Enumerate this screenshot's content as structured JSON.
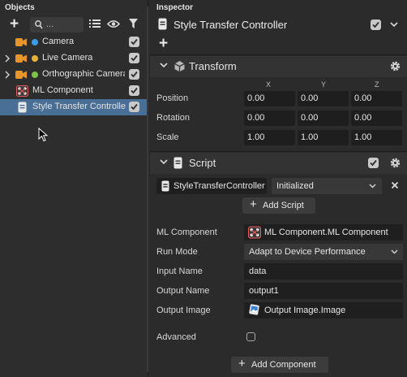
{
  "objects_panel": {
    "title": "Objects",
    "search": {
      "value": "...",
      "placeholder": ""
    },
    "items": [
      {
        "label": "Camera",
        "icon": "camera-icon",
        "dot_color": "#3a9ee6",
        "expandable": false,
        "checked": true,
        "selected": false
      },
      {
        "label": "Live Camera",
        "icon": "camera-icon",
        "dot_color": "#e6b23a",
        "expandable": true,
        "checked": true,
        "selected": false
      },
      {
        "label": "Orthographic Camera",
        "icon": "camera-icon",
        "dot_color": "#7fc24a",
        "expandable": true,
        "checked": true,
        "selected": false
      },
      {
        "label": "ML Component",
        "icon": "ml-component-icon",
        "dot_color": "",
        "expandable": false,
        "checked": true,
        "selected": false
      },
      {
        "label": "Style Transfer Controller",
        "icon": "script-icon",
        "dot_color": "",
        "expandable": false,
        "checked": true,
        "selected": true
      }
    ]
  },
  "inspector": {
    "title": "Inspector",
    "object_name": "Style Transfer Controller",
    "transform": {
      "title": "Transform",
      "axes": [
        "X",
        "Y",
        "Z"
      ],
      "rows": [
        {
          "label": "Position",
          "values": [
            "0.00",
            "0.00",
            "0.00"
          ]
        },
        {
          "label": "Rotation",
          "values": [
            "0.00",
            "0.00",
            "0.00"
          ]
        },
        {
          "label": "Scale",
          "values": [
            "1.00",
            "1.00",
            "1.00"
          ]
        }
      ]
    },
    "script": {
      "title": "Script",
      "script_file": "StyleTransferController",
      "status": "Initialized",
      "add_script_label": "Add Script",
      "fields": {
        "ml_component": {
          "label": "ML Component",
          "value": "ML Component.ML Component"
        },
        "run_mode": {
          "label": "Run Mode",
          "value": "Adapt to Device Performance"
        },
        "input_name": {
          "label": "Input Name",
          "value": "data"
        },
        "output_name": {
          "label": "Output Name",
          "value": "output1"
        },
        "output_image": {
          "label": "Output Image",
          "value": "Output Image.Image"
        },
        "advanced": {
          "label": "Advanced",
          "checked": false
        }
      }
    },
    "add_component_label": "Add Component"
  },
  "colors": {
    "panel_bg": "#2b2b2b",
    "selection": "#4a6f96",
    "camera_orange": "#e8962a",
    "field_bg": "#1f1f1f"
  }
}
